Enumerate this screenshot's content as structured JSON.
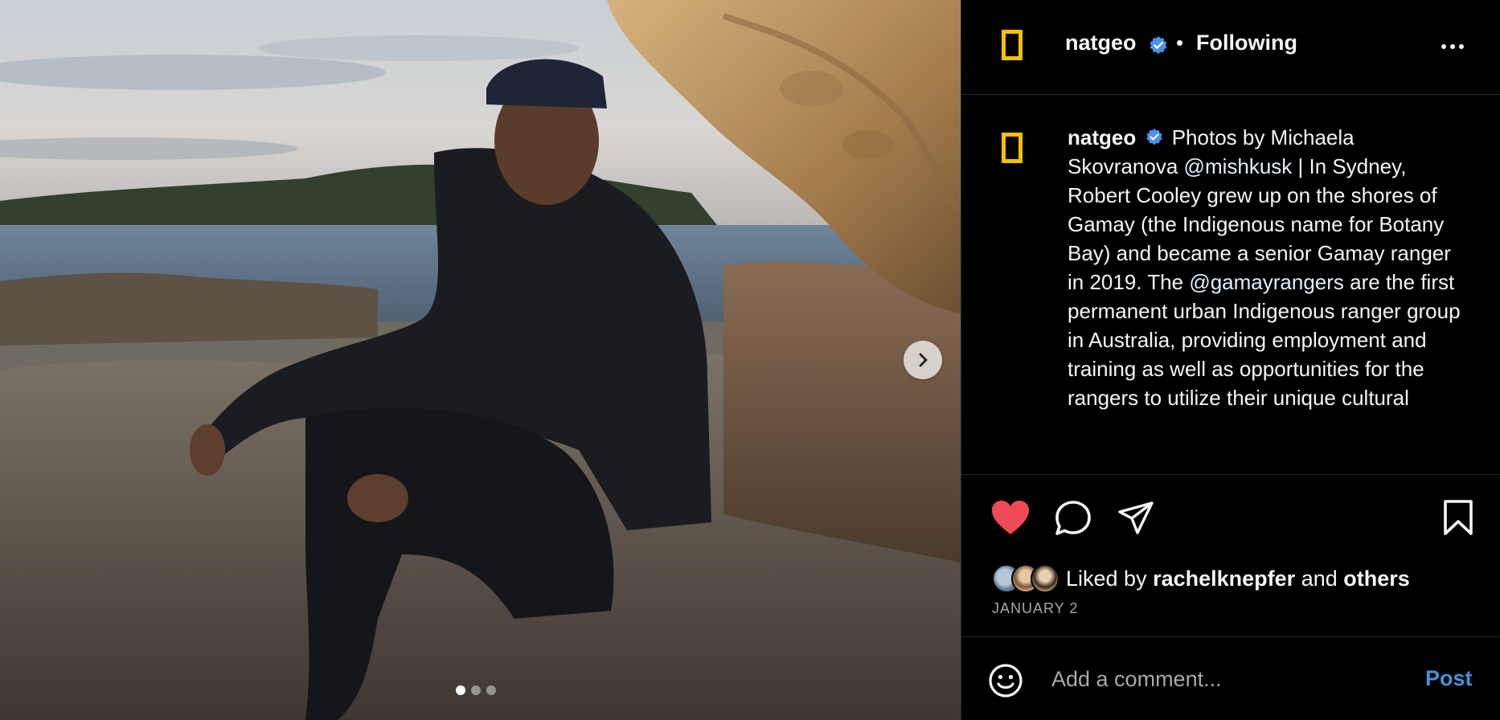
{
  "post": {
    "image_alt": "Robert Cooley seated on sandstone rocks at the shore of Botany Bay",
    "carousel": {
      "total": 3,
      "active_index": 0
    },
    "next_icon": "chevron-right-icon"
  },
  "header": {
    "username": "natgeo",
    "verified": true,
    "separator": "•",
    "follow_status": "Following",
    "more_icon": "more-horizontal-icon"
  },
  "caption": {
    "username": "natgeo",
    "text_part1": "Photos by Michaela Skovranova",
    "mention1": "@mishkusk",
    "text_part2": "| In Sydney, Robert Cooley grew up on the shores of Gamay (the Indigenous name for Botany Bay) and became a senior Gamay ranger in 2019. The",
    "mention2": "@gamayrangers",
    "text_part3": "are the first permanent urban Indigenous ranger group in Australia, providing employment and training as well as opportunities for the rangers to utilize their unique cultural"
  },
  "actions": {
    "like_icon": "heart-filled-icon",
    "comment_icon": "comment-icon",
    "share_icon": "paper-plane-icon",
    "save_icon": "bookmark-icon",
    "liked": true
  },
  "likes": {
    "prefix": "Liked by",
    "user": "rachelknepfer",
    "conjunction": "and",
    "others": "others"
  },
  "date": "JANUARY 2",
  "comment": {
    "placeholder": "Add a comment...",
    "post_label": "Post",
    "emoji_icon": "smiley-icon"
  },
  "colors": {
    "background": "#000000",
    "brand_yellow": "#f2c200",
    "like_red": "#ed4956",
    "link_blue": "#4a8fd9",
    "verified_blue": "#4c8ff1"
  }
}
